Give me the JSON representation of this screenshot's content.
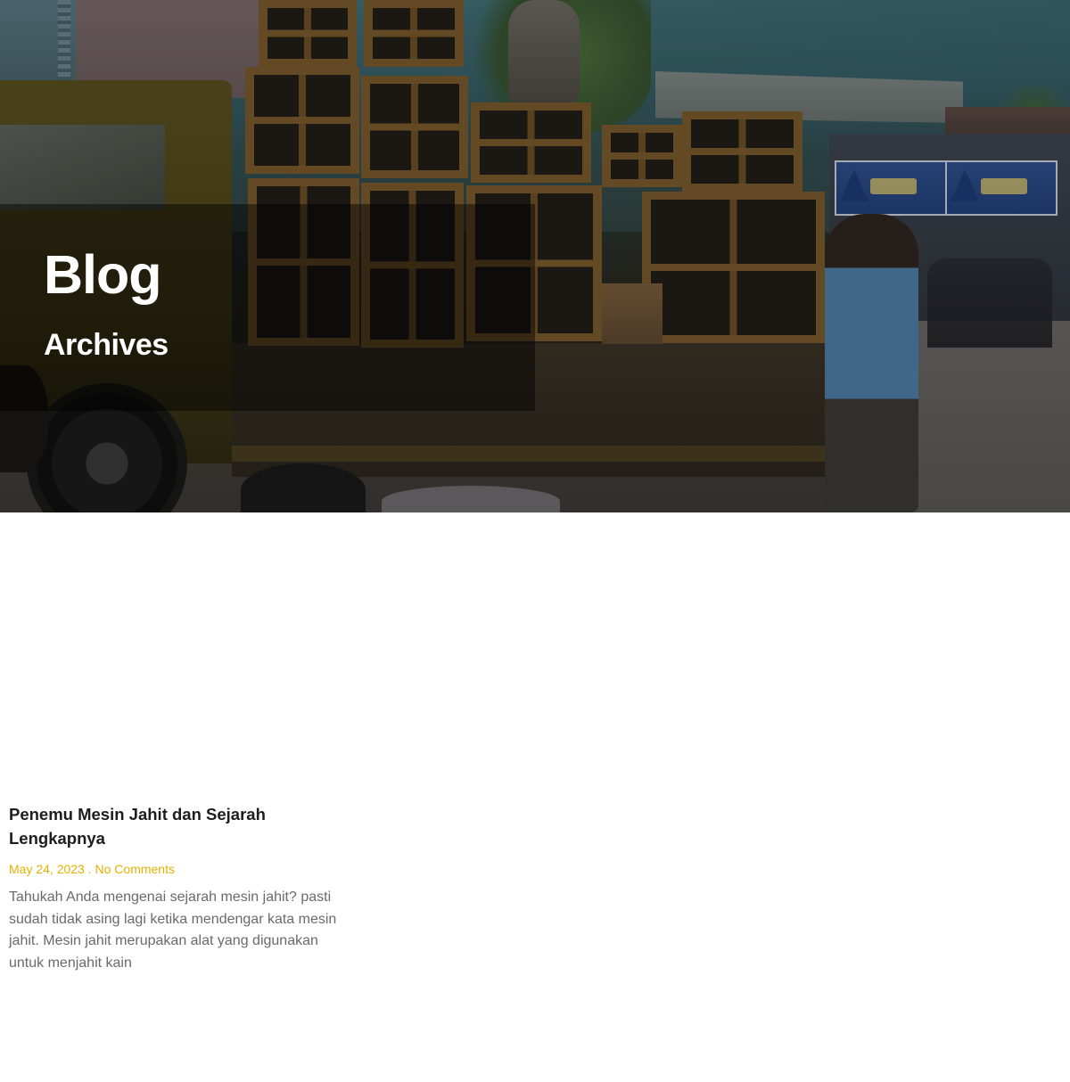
{
  "hero": {
    "title": "Blog",
    "subtitle": "Archives"
  },
  "posts": [
    {
      "title": "Penemu Mesin Jahit dan Sejarah Lengkapnya",
      "date": "May 24, 2023",
      "separator": ".",
      "comments": "No Comments",
      "excerpt": "Tahukah Anda mengenai sejarah mesin jahit? pasti sudah tidak asing lagi ketika mendengar kata mesin jahit. Mesin jahit merupakan alat yang digunakan untuk menjahit kain"
    }
  ],
  "colors": {
    "accent": "#e5b300",
    "title_text": "#1d1d1d",
    "body_text": "#6a6a6a",
    "hero_overlay": "rgba(0,0,0,0.45)"
  }
}
